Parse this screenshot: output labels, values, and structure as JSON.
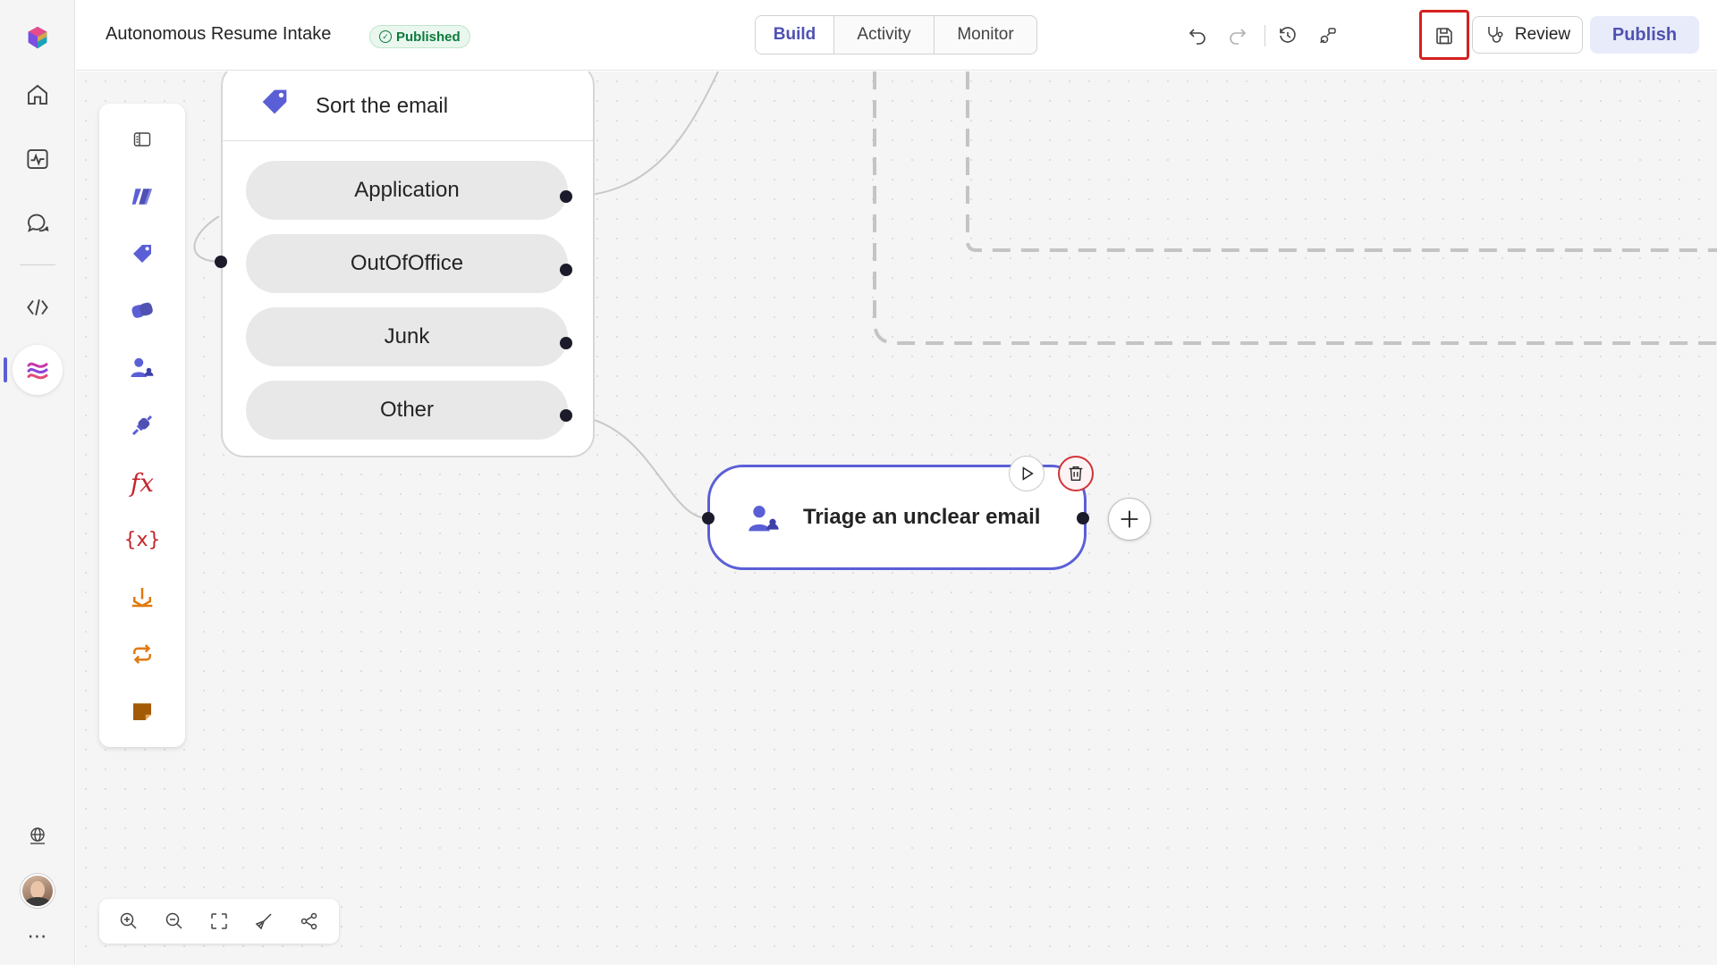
{
  "app": {
    "title": "Autonomous Resume Intake",
    "status": "Published"
  },
  "tabs": [
    {
      "label": "Build",
      "active": true
    },
    {
      "label": "Activity",
      "active": false
    },
    {
      "label": "Monitor",
      "active": false
    }
  ],
  "toolbar": {
    "review_label": "Review",
    "publish_label": "Publish",
    "icons": [
      "undo-icon",
      "redo-icon",
      "history-icon",
      "connections-icon",
      "save-icon",
      "run-icon",
      "more-icon",
      "stethoscope-icon"
    ],
    "highlighted": "save-icon"
  },
  "rail": {
    "items": [
      "app-logo-icon",
      "home-icon",
      "activity-icon",
      "chat-icon",
      "code-icon",
      "agent-flow-icon",
      "globe-icon",
      "avatar",
      "more-icon"
    ],
    "active": "agent-flow-icon"
  },
  "palette": {
    "items": [
      "panel-toggle-icon",
      "ai-prompt-icon",
      "tag-icon",
      "copilot-icon",
      "human-review-icon",
      "connector-icon",
      "formula-icon",
      "variable-icon",
      "condition-icon",
      "loop-icon",
      "sticky-note-icon"
    ]
  },
  "nodes": {
    "sort": {
      "title": "Sort the email",
      "branches": [
        "Application",
        "OutOfOffice",
        "Junk",
        "Other"
      ]
    },
    "triage": {
      "title": "Triage an unclear email"
    }
  },
  "zoom_controls": [
    "zoom-in-icon",
    "zoom-out-icon",
    "fit-view-icon",
    "tidy-icon",
    "layout-icon"
  ],
  "colors": {
    "accent": "#5b5fd6",
    "published_green": "#0e7a3d",
    "highlight_red": "#d42020",
    "formula_red": "#c4262e",
    "orange": "#e07a10"
  }
}
